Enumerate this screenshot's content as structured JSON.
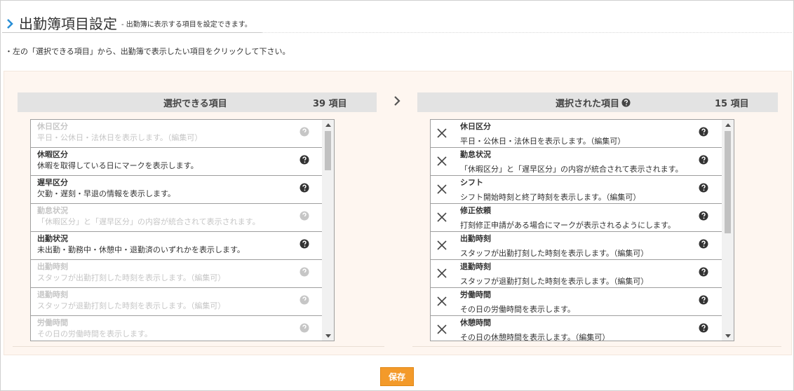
{
  "header": {
    "title": "出勤簿項目設定",
    "subtitle": "- 出勤簿に表示する項目を設定できます。"
  },
  "instruction": "・左の「選択できる項目」から、出勤簿で表示したい項目をクリックして下さい。",
  "available": {
    "title": "選択できる項目",
    "count": "39 項目",
    "items": [
      {
        "name": "休日区分",
        "desc": "平日・公休日・法休日を表示します。（編集可）",
        "disabled": true
      },
      {
        "name": "休暇区分",
        "desc": "休暇を取得している日にマークを表示します。",
        "disabled": false
      },
      {
        "name": "遅早区分",
        "desc": "欠勤・遅刻・早退の情報を表示します。",
        "disabled": false
      },
      {
        "name": "勤怠状況",
        "desc": "「休暇区分」と「遅早区分」の内容が統合されて表示されます。",
        "disabled": true
      },
      {
        "name": "出勤状況",
        "desc": "未出勤・勤務中・休憩中・退勤済のいずれかを表示します。",
        "disabled": false
      },
      {
        "name": "出勤時刻",
        "desc": "スタッフが出勤打刻した時刻を表示します。（編集可）",
        "disabled": true
      },
      {
        "name": "退勤時刻",
        "desc": "スタッフが退勤打刻した時刻を表示します。（編集可）",
        "disabled": true
      },
      {
        "name": "労働時間",
        "desc": "その日の労働時間を表示します。",
        "disabled": true
      }
    ]
  },
  "selected": {
    "title": "選択された項目",
    "count": "15 項目",
    "items": [
      {
        "name": "休日区分",
        "desc": "平日・公休日・法休日を表示します。（編集可）"
      },
      {
        "name": "勤怠状況",
        "desc": "「休暇区分」と「遅早区分」の内容が統合されて表示されます。"
      },
      {
        "name": "シフト",
        "desc": "シフト開始時刻と終了時刻を表示します。（編集可）"
      },
      {
        "name": "修正依頼",
        "desc": "打刻修正申請がある場合にマークが表示されるようにします。"
      },
      {
        "name": "出勤時刻",
        "desc": "スタッフが出勤打刻した時刻を表示します。（編集可）"
      },
      {
        "name": "退勤時刻",
        "desc": "スタッフが退勤打刻した時刻を表示します。（編集可）"
      },
      {
        "name": "労働時間",
        "desc": "その日の労働時間を表示します。"
      },
      {
        "name": "休憩時間",
        "desc": "その日の休憩時間を表示します。（編集可）"
      }
    ]
  },
  "save_label": "保存",
  "colors": {
    "accent": "#f39a2a",
    "chevron": "#2a8fd6",
    "panel": "#fef6f0",
    "header_bar": "#e3e3e3"
  }
}
